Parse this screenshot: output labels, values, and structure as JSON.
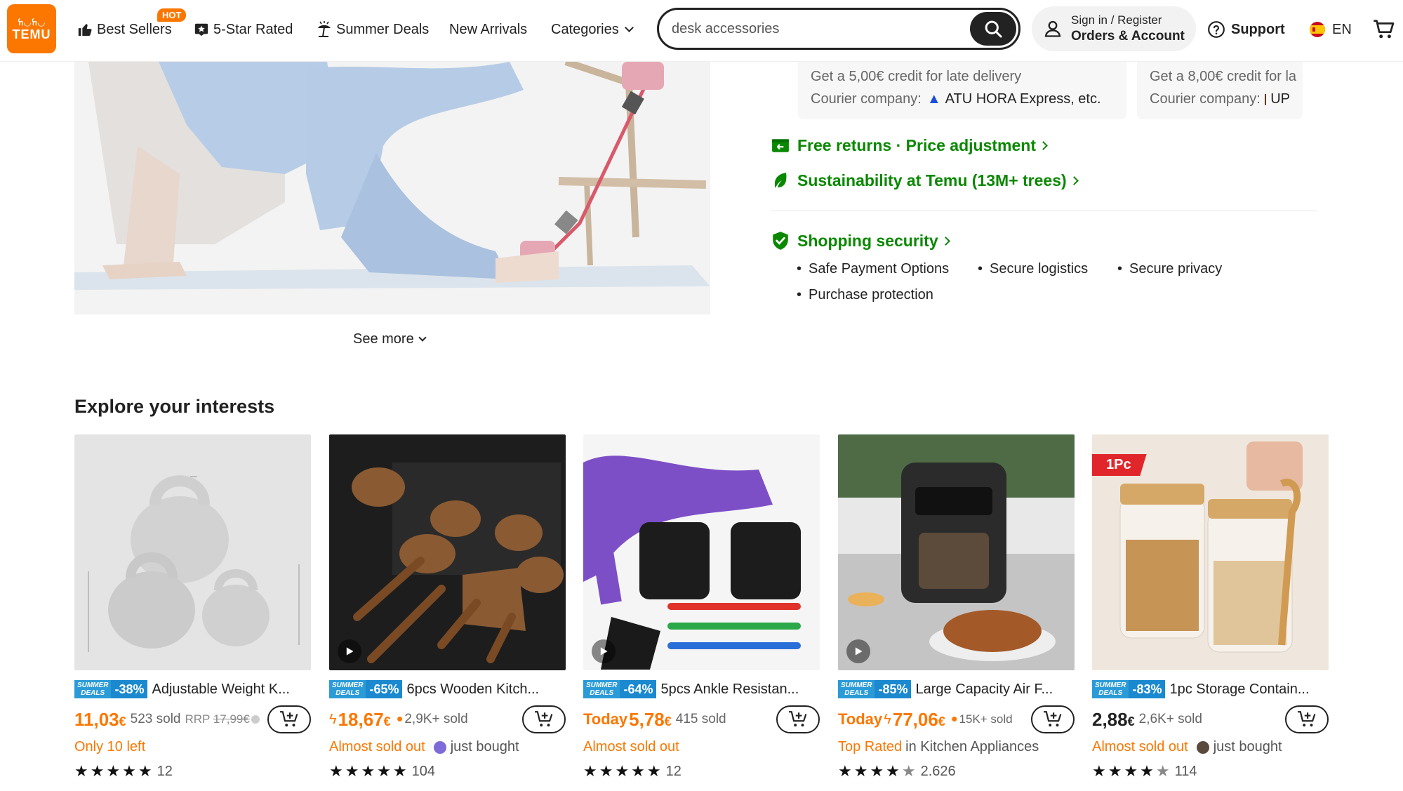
{
  "header": {
    "logo_line1": "ꖷ◡ꖷ◡",
    "logo_line2": "TEMU",
    "nav": {
      "best_sellers": "Best Sellers",
      "hot_badge": "HOT",
      "five_star": "5-Star Rated",
      "summer_deals": "Summer Deals",
      "new_arrivals": "New Arrivals",
      "categories": "Categories"
    },
    "search_value": "desk accessories",
    "signin_line1": "Sign in / Register",
    "signin_line2": "Orders & Account",
    "support": "Support",
    "language": "EN"
  },
  "hero": {
    "see_more": "See more"
  },
  "delivery": {
    "card1_line1": "Get a 5,00€ credit for late delivery",
    "card1_courier_label": "Courier company:",
    "card1_courier": "ATU HORA Express, etc.",
    "card2_line1": "Get a 8,00€ credit for la",
    "card2_courier_label": "Courier company:",
    "card2_courier": "UP"
  },
  "links": {
    "returns": "Free returns · Price adjustment",
    "sustainability": "Sustainability at Temu (13M+ trees)",
    "security": "Shopping security"
  },
  "security_items": [
    "Safe Payment Options",
    "Secure logistics",
    "Secure privacy",
    "Purchase protection"
  ],
  "explore": {
    "title": "Explore your interests",
    "badge_label_1": "SUMMER",
    "badge_label_2": "DEALS",
    "products": [
      {
        "discount": "-38%",
        "title": "Adjustable Weight K...",
        "price_main": "11,03",
        "price_cur": "€",
        "sold": "523 sold",
        "rrp_label": "RRP",
        "rrp": "17,99€",
        "meta": "Only 10 left",
        "rating_count": "12",
        "stars": 5
      },
      {
        "discount": "-65%",
        "title": "6pcs Wooden Kitch...",
        "price_main": "18,67",
        "price_cur": "€",
        "sold": "2,9K+ sold",
        "meta_1": "Almost sold out",
        "meta_2": "just bought",
        "rating_count": "104",
        "stars": 5
      },
      {
        "discount": "-64%",
        "title": "5pcs Ankle Resistan...",
        "today": "Today",
        "price_main": "5,78",
        "price_cur": "€",
        "sold": "415 sold",
        "meta": "Almost sold out",
        "rating_count": "12",
        "stars": 5
      },
      {
        "discount": "-85%",
        "title": "Large Capacity Air F...",
        "today": "Today",
        "price_main": "77,06",
        "price_cur": "€",
        "sold": "15K+ sold",
        "meta_1": "Top Rated",
        "meta_2": "in Kitchen Appliances",
        "rating_count": "2.626",
        "stars": 4.5
      },
      {
        "discount": "-83%",
        "title": "1pc Storage Contain...",
        "price_main": "2,88",
        "price_cur": "€",
        "sold": "2,6K+ sold",
        "meta_1": "Almost sold out",
        "meta_2": "just bought",
        "rating_count": "114",
        "stars": 4.5,
        "tag": "1Pc"
      }
    ]
  },
  "colors": {
    "brand": "#fb7701",
    "green": "#0a8800",
    "deal_blue": "#1b89cf"
  },
  "icons": [
    "thumb-up-icon",
    "star-badge-icon",
    "sun-umbrella-icon",
    "chevron-down-icon",
    "search-icon",
    "user-icon",
    "help-circle-icon",
    "spain-flag-icon",
    "cart-icon",
    "truck-returns-icon",
    "leaf-icon",
    "shield-check-icon",
    "add-to-cart-icon",
    "play-icon",
    "flash-icon",
    "fire-icon"
  ]
}
